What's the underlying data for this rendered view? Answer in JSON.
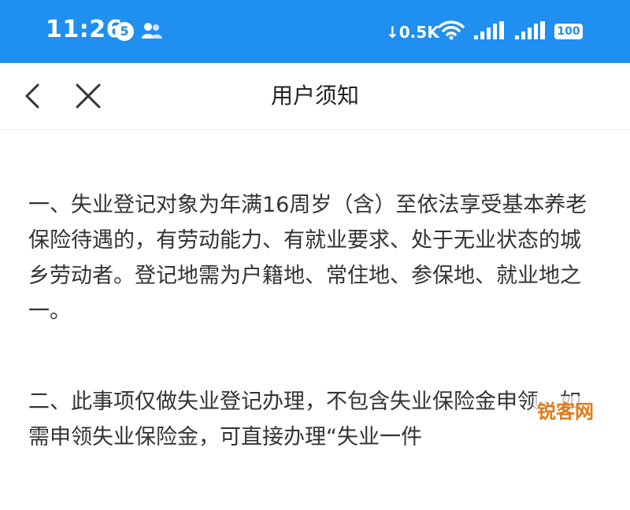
{
  "status_bar": {
    "time": "11:26",
    "notification_count": "5",
    "network_speed": "0.5K",
    "battery": "100",
    "background_color": "#1f8ff0"
  },
  "nav": {
    "title": "用户须知",
    "back_icon": "chevron-left-icon",
    "close_icon": "close-icon"
  },
  "content": {
    "paragraphs": [
      "一、失业登记对象为年满16周岁（含）至依法享受基本养老保险待遇的，有劳动能力、有就业要求、处于无业状态的城乡劳动者。登记地需为户籍地、常住地、参保地、就业地之一。",
      "二、此事项仅做失业登记办理，不包含失业保险金申领，如需申领失业保险金，可直接办理“失业一件"
    ]
  },
  "watermark": "锐客网"
}
